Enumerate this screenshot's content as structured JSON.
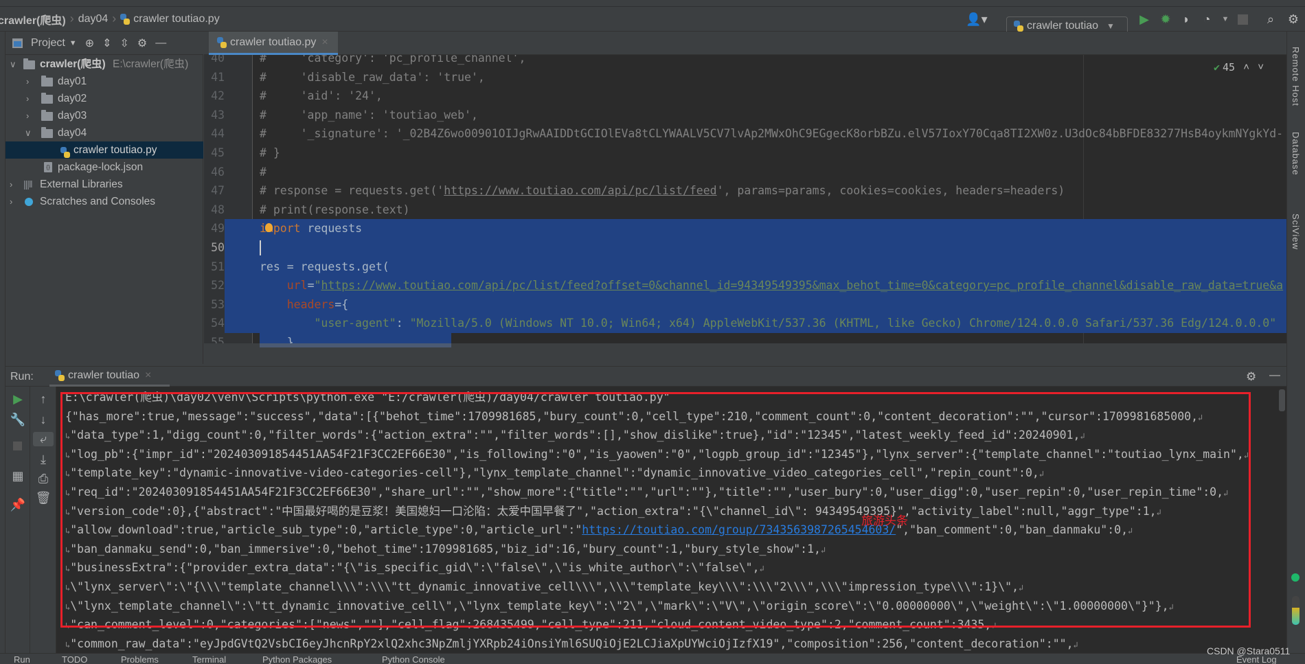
{
  "navbar": {
    "crumbs": [
      "crawler(爬虫)",
      "day04",
      "crawler toutiao.py"
    ],
    "run_config": "crawler toutiao"
  },
  "project": {
    "header_label": "Project",
    "tree": [
      {
        "label": "crawler(爬虫)",
        "hint": "E:\\crawler(爬虫)",
        "type": "folder",
        "expanded": true
      },
      {
        "label": "day01",
        "type": "folder",
        "expanded": false
      },
      {
        "label": "day02",
        "type": "folder",
        "expanded": false
      },
      {
        "label": "day03",
        "type": "folder",
        "expanded": false
      },
      {
        "label": "day04",
        "type": "folder",
        "expanded": true
      },
      {
        "label": "crawler toutiao.py",
        "type": "python-file",
        "selected": true
      },
      {
        "label": "package-lock.json",
        "type": "json-file"
      },
      {
        "label": "External Libraries",
        "type": "library"
      },
      {
        "label": "Scratches and Consoles",
        "type": "scratches"
      }
    ]
  },
  "editor": {
    "tab_label": "crawler toutiao.py",
    "inspection_count": "45",
    "current_line": 50,
    "lines": [
      {
        "n": "40",
        "tokens": [
          [
            "#     'category': 'pc_profile_channel',",
            "comment"
          ]
        ]
      },
      {
        "n": "41",
        "tokens": [
          [
            "#     'disable_raw_data': 'true',",
            "comment"
          ]
        ]
      },
      {
        "n": "42",
        "tokens": [
          [
            "#     'aid': '24',",
            "comment"
          ]
        ]
      },
      {
        "n": "43",
        "tokens": [
          [
            "#     'app_name': 'toutiao_web',",
            "comment"
          ]
        ]
      },
      {
        "n": "44",
        "tokens": [
          [
            "#     '_signature': '_02B4Z6wo00901OIJgRwAAIDDtGCIOlEVa8tCLYWAALV5CV7lvAp2MWxOhC9EGgecK8orbBZu.elV57IoxY70Cqa8TI2XW0z.U3dOc84bBFDE83277HsB4oykmNYgkYd-",
            "comment"
          ]
        ]
      },
      {
        "n": "45",
        "tokens": [
          [
            "# }",
            "comment"
          ]
        ]
      },
      {
        "n": "46",
        "tokens": [
          [
            "#",
            "comment"
          ]
        ]
      },
      {
        "n": "47",
        "tokens": [
          [
            "# response = requests.get('",
            "comment"
          ],
          [
            "https://www.toutiao.com/api/pc/list/feed",
            "comment-link"
          ],
          [
            "', params=params, cookies=cookies, headers=headers)",
            "comment"
          ]
        ]
      },
      {
        "n": "48",
        "tokens": [
          [
            "# print(response.text)",
            "comment"
          ]
        ]
      },
      {
        "n": "49",
        "tokens": [
          [
            "import",
            "kw"
          ],
          [
            " requests",
            "plain"
          ]
        ]
      },
      {
        "n": "50",
        "tokens": []
      },
      {
        "n": "51",
        "tokens": [
          [
            "res = requests.get(",
            "plain"
          ]
        ]
      },
      {
        "n": "52",
        "tokens": [
          [
            "    ",
            "plain"
          ],
          [
            "url",
            "param"
          ],
          [
            "=",
            "plain"
          ],
          [
            "\"",
            "str"
          ],
          [
            "https://www.toutiao.com/api/pc/list/feed?offset=0&channel_id=94349549395&max_behot_time=0&category=pc_profile_channel&disable_raw_data=true&a",
            "link"
          ]
        ]
      },
      {
        "n": "53",
        "tokens": [
          [
            "    ",
            "plain"
          ],
          [
            "headers",
            "param"
          ],
          [
            "={",
            "plain"
          ]
        ]
      },
      {
        "n": "54",
        "tokens": [
          [
            "        ",
            "plain"
          ],
          [
            "\"user-agent\"",
            "str"
          ],
          [
            ": ",
            "plain"
          ],
          [
            "\"Mozilla/5.0 (Windows NT 10.0; Win64; x64) AppleWebKit/537.36 (KHTML, like Gecko) Chrome/124.0.0.0 Safari/537.36 Edg/124.0.0.0\"",
            "str"
          ]
        ]
      },
      {
        "n": "55",
        "tokens": [
          [
            "    }",
            "plain"
          ]
        ]
      }
    ]
  },
  "right_tools": [
    "Remote Host",
    "Database",
    "SciView"
  ],
  "run": {
    "label": "Run:",
    "tab_label": "crawler toutiao",
    "annotation": "旅游头条",
    "lines": [
      {
        "text": "E:\\crawler(爬虫)\\day02\\venv\\Scripts\\python.exe \"E:/crawler(爬虫)/day04/crawler toutiao.py\"",
        "wrap_in": false,
        "wrap_out": false
      },
      {
        "text": "{\"has_more\":true,\"message\":\"success\",\"data\":[{\"behot_time\":1709981685,\"bury_count\":0,\"cell_type\":210,\"comment_count\":0,\"content_decoration\":\"\",\"cursor\":1709981685000,",
        "wrap_in": false,
        "wrap_out": true
      },
      {
        "text": "\"data_type\":1,\"digg_count\":0,\"filter_words\":{\"action_extra\":\"\",\"filter_words\":[],\"show_dislike\":true},\"id\":\"12345\",\"latest_weekly_feed_id\":20240901,",
        "wrap_in": true,
        "wrap_out": true
      },
      {
        "text": "\"log_pb\":{\"impr_id\":\"202403091854451AA54F21F3CC2EF66E30\",\"is_following\":\"0\",\"is_yaowen\":\"0\",\"logpb_group_id\":\"12345\"},\"lynx_server\":{\"template_channel\":\"toutiao_lynx_main\",",
        "wrap_in": true,
        "wrap_out": true
      },
      {
        "text": "\"template_key\":\"dynamic-innovative-video-categories-cell\"},\"lynx_template_channel\":\"dynamic_innovative_video_categories_cell\",\"repin_count\":0,",
        "wrap_in": true,
        "wrap_out": true
      },
      {
        "text": "\"req_id\":\"202403091854451AA54F21F3CC2EF66E30\",\"share_url\":\"\",\"show_more\":{\"title\":\"\",\"url\":\"\"},\"title\":\"\",\"user_bury\":0,\"user_digg\":0,\"user_repin\":0,\"user_repin_time\":0,",
        "wrap_in": true,
        "wrap_out": true
      },
      {
        "text": "\"version_code\":0},{\"abstract\":\"中国最好喝的是豆浆！美国媳妇一口沦陷：太爱中国早餐了\",\"action_extra\":\"{\\\"channel_id\\\": 94349549395}\",\"activity_label\":null,\"aggr_type\":1,",
        "wrap_in": true,
        "wrap_out": true
      },
      {
        "text": "\"allow_download\":true,\"article_sub_type\":0,\"article_type\":0,\"article_url\":\"",
        "link": "https://toutiao.com/group/7343563987265454603/",
        "after": "\",\"ban_comment\":0,\"ban_danmaku\":0,",
        "wrap_in": true,
        "wrap_out": true
      },
      {
        "text": "\"ban_danmaku_send\":0,\"ban_immersive\":0,\"behot_time\":1709981685,\"biz_id\":16,\"bury_count\":1,\"bury_style_show\":1,",
        "wrap_in": true,
        "wrap_out": true
      },
      {
        "text": "\"businessExtra\":{\"provider_extra_data\":\"{\\\"is_specific_gid\\\":\\\"false\\\",\\\"is_white_author\\\":\\\"false\\\",",
        "wrap_in": true,
        "wrap_out": true
      },
      {
        "text": "\\\"lynx_server\\\":\\\"{\\\\\\\"template_channel\\\\\\\":\\\\\\\"tt_dynamic_innovative_cell\\\\\\\",\\\\\\\"template_key\\\\\\\":\\\\\\\"2\\\\\\\",\\\\\\\"impression_type\\\\\\\":1}\\\",",
        "wrap_in": true,
        "wrap_out": true
      },
      {
        "text": "\\\"lynx_template_channel\\\":\\\"tt_dynamic_innovative_cell\\\",\\\"lynx_template_key\\\":\\\"2\\\",\\\"mark\\\":\\\"V\\\",\\\"origin_score\\\":\\\"0.00000000\\\",\\\"weight\\\":\\\"1.00000000\\\"}\"},",
        "wrap_in": true,
        "wrap_out": true
      },
      {
        "text": "\"can_comment_level\":0,\"categories\":[\"news\",\"\"],\"cell_flag\":268435499,\"cell_type\":211,\"cloud_content_video_type\":2,\"comment_count\":3435,",
        "wrap_in": true,
        "wrap_out": true
      },
      {
        "text": "\"common_raw_data\":\"eyJpdGVtQ2VsbCI6eyJhcnRpY2xlQ2xhc3NpZmljYXRpb24iOnsiYml6SUQiOjE2LCJiaXpUYWciOjIzfX19\",\"composition\":256,\"content_decoration\":\"\",",
        "wrap_in": true,
        "wrap_out": true
      }
    ]
  },
  "bottom_tabs": [
    "Run",
    "TODO",
    "Problems",
    "Terminal",
    "Python Packages",
    "Python Console",
    "Event Log"
  ],
  "watermark": "CSDN @Stara0511",
  "colors": {
    "accent": "#4a88c7",
    "selection": "#214283",
    "highlight_box": "#e8202a",
    "run_green": "#499c54"
  }
}
